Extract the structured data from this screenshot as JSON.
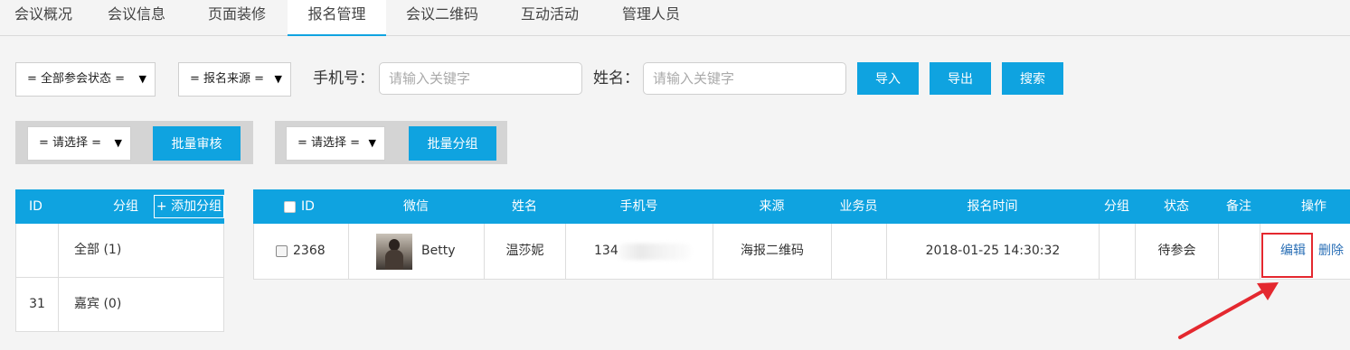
{
  "tabs": [
    {
      "label": "会议概况"
    },
    {
      "label": "会议信息"
    },
    {
      "label": "页面装修"
    },
    {
      "label": "报名管理"
    },
    {
      "label": "会议二维码"
    },
    {
      "label": "互动活动"
    },
    {
      "label": "管理人员"
    }
  ],
  "active_tab": "报名管理",
  "filters": {
    "status_select": "= 全部参会状态 =",
    "source_select": "= 报名来源 =",
    "phone_label": "手机号：",
    "phone_placeholder": "请输入关键字",
    "name_label": "姓名：",
    "name_placeholder": "请输入关键字",
    "import_label": "导入",
    "export_label": "导出",
    "search_label": "搜索"
  },
  "batch": {
    "audit_select": "= 请选择 =",
    "audit_button": "批量审核",
    "group_select": "= 请选择 =",
    "group_button": "批量分组"
  },
  "group_table": {
    "headers": {
      "id": "ID",
      "group": "分组",
      "add_button": "+ 添加分组"
    },
    "rows": [
      {
        "id": "",
        "name": "全部 (1)"
      },
      {
        "id": "31",
        "name": "嘉宾 (0)"
      }
    ]
  },
  "main_table": {
    "headers": {
      "id": "ID",
      "wechat": "微信",
      "name": "姓名",
      "phone": "手机号",
      "source": "来源",
      "salesperson": "业务员",
      "signup_time": "报名时间",
      "group": "分组",
      "status": "状态",
      "remark": "备注",
      "actions": "操作"
    },
    "rows": [
      {
        "id": "2368",
        "wechat": "Betty",
        "name": "温莎妮",
        "phone": "134",
        "source": "海报二维码",
        "salesperson": "",
        "signup_time": "2018-01-25 14:30:32",
        "group": "",
        "status": "待参会",
        "remark": "",
        "edit_label": "编辑",
        "delete_label": "删除"
      }
    ]
  },
  "colors": {
    "accent": "#0fa3e0",
    "highlight": "#e4282f",
    "link": "#2a6fb6"
  },
  "icons": {
    "select_caret": "▼",
    "checkbox": "checkbox",
    "annotation_arrow": "red-arrow"
  }
}
